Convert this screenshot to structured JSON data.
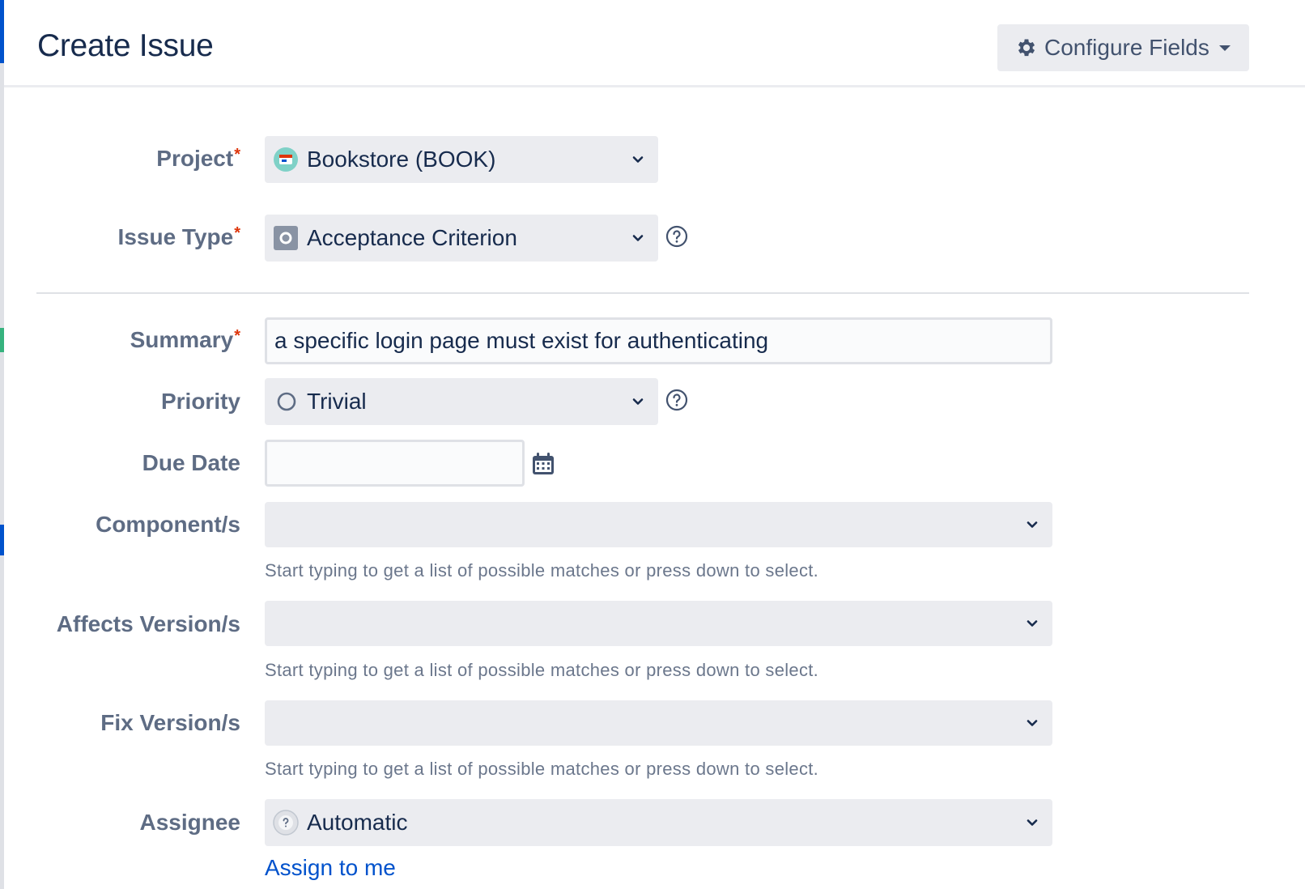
{
  "dialog": {
    "title": "Create Issue",
    "configure_label": "Configure Fields"
  },
  "form": {
    "project": {
      "label": "Project",
      "value": "Bookstore (BOOK)"
    },
    "issue_type": {
      "label": "Issue Type",
      "value": "Acceptance Criterion"
    },
    "summary": {
      "label": "Summary",
      "value": "a specific login page must exist for authenticating"
    },
    "priority": {
      "label": "Priority",
      "value": "Trivial"
    },
    "due_date": {
      "label": "Due Date",
      "value": ""
    },
    "components": {
      "label": "Component/s",
      "hint": "Start typing to get a list of possible matches or press down to select."
    },
    "affects_versions": {
      "label": "Affects Version/s",
      "hint": "Start typing to get a list of possible matches or press down to select."
    },
    "fix_versions": {
      "label": "Fix Version/s",
      "hint": "Start typing to get a list of possible matches or press down to select."
    },
    "assignee": {
      "label": "Assignee",
      "value": "Automatic",
      "link": "Assign to me"
    },
    "required_marker": "*"
  },
  "colors": {
    "accent": "#0052cc",
    "required": "#de350b",
    "label": "#5e6c84",
    "field_bg": "#ebecf0"
  },
  "icons": {
    "configure": "gear-icon",
    "project": "project-avatar-icon",
    "issue_type": "acceptance-criterion-icon",
    "priority": "trivial-priority-icon",
    "help": "help-icon",
    "calendar": "calendar-icon",
    "dropdown": "chevron-down-icon",
    "assignee": "unknown-avatar-icon"
  }
}
